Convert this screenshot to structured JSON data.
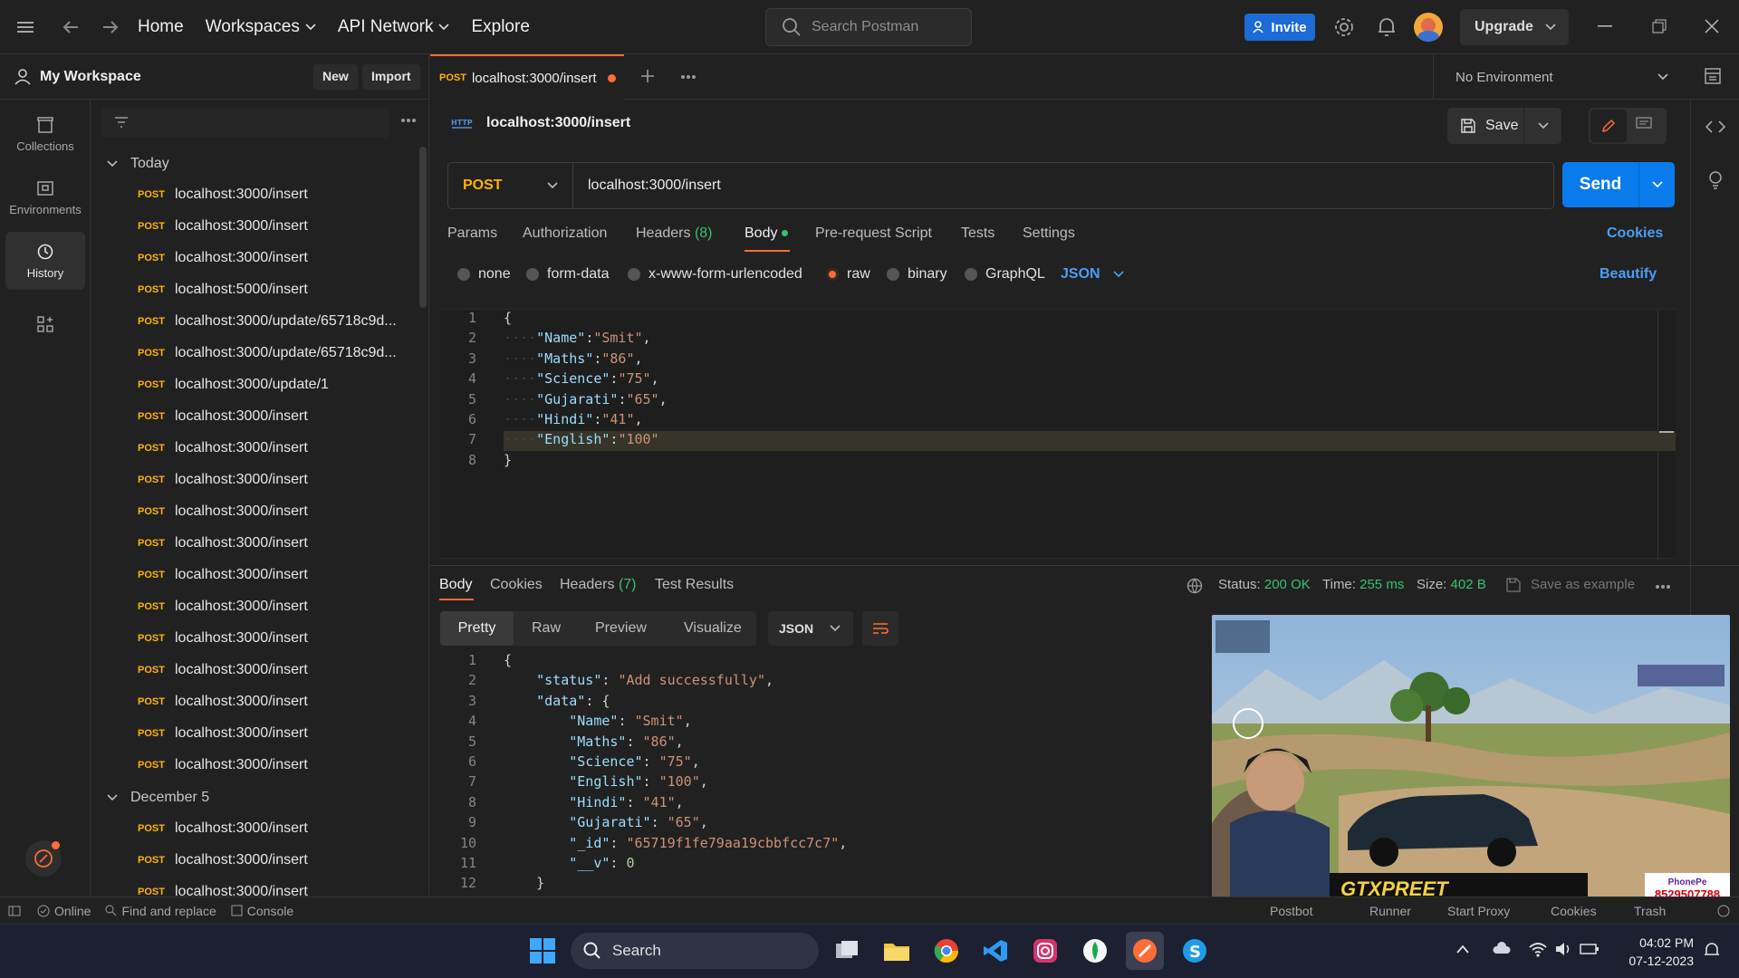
{
  "topbar": {
    "nav": [
      "Home",
      "Workspaces",
      "API Network",
      "Explore"
    ],
    "search_placeholder": "Search Postman",
    "invite_label": "Invite",
    "upgrade_label": "Upgrade"
  },
  "rail": {
    "items": [
      {
        "label": "Collections",
        "icon": "collections-icon"
      },
      {
        "label": "Environments",
        "icon": "environments-icon"
      },
      {
        "label": "History",
        "icon": "history-icon"
      },
      {
        "label": "",
        "icon": "configure-icon"
      }
    ]
  },
  "sidebar": {
    "workspace_name": "My Workspace",
    "new_label": "New",
    "import_label": "Import",
    "groups": [
      {
        "label": "Today",
        "items": [
          {
            "method": "POST",
            "url": "localhost:3000/insert"
          },
          {
            "method": "POST",
            "url": "localhost:3000/insert"
          },
          {
            "method": "POST",
            "url": "localhost:3000/insert"
          },
          {
            "method": "POST",
            "url": "localhost:5000/insert"
          },
          {
            "method": "POST",
            "url": "localhost:3000/update/65718c9d..."
          },
          {
            "method": "POST",
            "url": "localhost:3000/update/65718c9d..."
          },
          {
            "method": "POST",
            "url": "localhost:3000/update/1"
          },
          {
            "method": "POST",
            "url": "localhost:3000/insert"
          },
          {
            "method": "POST",
            "url": "localhost:3000/insert"
          },
          {
            "method": "POST",
            "url": "localhost:3000/insert"
          },
          {
            "method": "POST",
            "url": "localhost:3000/insert"
          },
          {
            "method": "POST",
            "url": "localhost:3000/insert"
          },
          {
            "method": "POST",
            "url": "localhost:3000/insert"
          },
          {
            "method": "POST",
            "url": "localhost:3000/insert"
          },
          {
            "method": "POST",
            "url": "localhost:3000/insert"
          },
          {
            "method": "POST",
            "url": "localhost:3000/insert"
          },
          {
            "method": "POST",
            "url": "localhost:3000/insert"
          },
          {
            "method": "POST",
            "url": "localhost:3000/insert"
          },
          {
            "method": "POST",
            "url": "localhost:3000/insert"
          }
        ]
      },
      {
        "label": "December 5",
        "items": [
          {
            "method": "POST",
            "url": "localhost:3000/insert"
          },
          {
            "method": "POST",
            "url": "localhost:3000/insert"
          },
          {
            "method": "POST",
            "url": "localhost:3000/insert"
          }
        ]
      }
    ]
  },
  "tab": {
    "method": "POST",
    "title": "localhost:3000/insert"
  },
  "environment": "No Environment",
  "request": {
    "title": "localhost:3000/insert",
    "save_label": "Save",
    "method": "POST",
    "url": "localhost:3000/insert",
    "send_label": "Send",
    "tabs": [
      "Params",
      "Authorization",
      "Headers",
      "Body",
      "Pre-request Script",
      "Tests",
      "Settings"
    ],
    "headers_count": "(8)",
    "cookies_label": "Cookies",
    "body_modes": [
      "none",
      "form-data",
      "x-www-form-urlencoded",
      "raw",
      "binary",
      "GraphQL"
    ],
    "body_format": "JSON",
    "beautify_label": "Beautify",
    "body_lines": [
      "{",
      "····\"Name\":\"Smit\",",
      "····\"Maths\":\"86\",",
      "····\"Science\":\"75\",",
      "····\"Gujarati\":\"65\",",
      "····\"Hindi\":\"41\",",
      "····\"English\":\"100\"",
      "}"
    ]
  },
  "response": {
    "tabs": [
      "Body",
      "Cookies",
      "Headers",
      "Test Results"
    ],
    "headers_count": "(7)",
    "status_label": "Status:",
    "status": "200 OK",
    "time_label": "Time:",
    "time": "255 ms",
    "size_label": "Size:",
    "size": "402 B",
    "save_example": "Save as example",
    "view_tabs": [
      "Pretty",
      "Raw",
      "Preview",
      "Visualize"
    ],
    "format": "JSON",
    "lines": [
      "{",
      "    \"status\": \"Add successfully\",",
      "    \"data\": {",
      "        \"Name\": \"Smit\",",
      "        \"Maths\": \"86\",",
      "        \"Science\": \"75\",",
      "        \"English\": \"100\",",
      "        \"Hindi\": \"41\",",
      "        \"Gujarati\": \"65\",",
      "        \"_id\": \"65719f1fe79aa19cbbfcc7c7\",",
      "        \"__v\": 0",
      "    }"
    ]
  },
  "statusbar": {
    "left": [
      "Online",
      "Find and replace",
      "Console"
    ],
    "right": [
      "Postbot",
      "Runner",
      "Start Proxy",
      "Cookies",
      "Trash"
    ]
  },
  "taskbar": {
    "search_label": "Search",
    "time": "04:02 PM",
    "date": "07-12-2023"
  },
  "overlay": {
    "banner": "GTXPREET",
    "phone": "8529507788",
    "brand": "PhonePe"
  },
  "colors": {
    "accent": "#ff6c37",
    "send": "#097bed",
    "method_post": "#ffb400",
    "status_ok": "#38c172"
  }
}
